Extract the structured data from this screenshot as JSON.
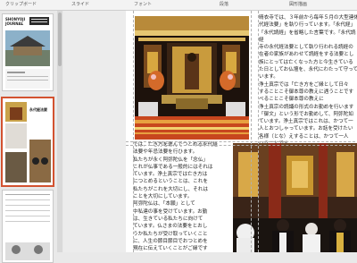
{
  "ribbon": {
    "groups": [
      "クリップボード",
      "スライド",
      "フォント",
      "段落",
      "図形描画"
    ]
  },
  "thumbnails": [
    {
      "masthead": "SHONYOJI\nJOURNAL"
    },
    {
      "masthead": "永代経法要"
    },
    {
      "masthead": ""
    }
  ],
  "document": {
    "right_column": "晴衣寺では、３年前から毎年５月の大型連休\n代経法要」を執り行っています。「永代経」\n「永代読経」を省略した言葉です。「永代読経\n寺の永代経法要として執り行われる読経の\n在者の家族があわせて読経をする法要とし\n族にとっては亡くなった方と今生きている\nた日としてお仏壇を、永代にわたって守って\nいます。\n浄土真宗では「亡き方をご縁として日々\nすることこそ御本尊の教えに遇うことです\nべることこそ御本尊の教えに\n浄土真宗の読誦の形式のお勤めを行います\n「御文」という形でお勤めして、阿弥陀如\nています。浄土真宗ではこれは、かつて一\n人とおつしゃっています。お話を受けたい\n各様（とな）えすることは、かつて一人\nいうことです。",
    "left_column": "では、亡き方を偲んでつとめる永代経\n法要や年忌法要を行ひます。\n私たちが永く阿弥陀仏を「念仏」\nこれが仏事である一般的にはそれは\nています。浄土真宗では亡き方は\nにつとめるということは、これを\n私たちがこれを大切にし、それは\nことを大切にしています。\n阿弥陀仏は、「本願」として\n中私達の事を受けています。お勤\nは、生きている私たちに向けて\nています。仏さまの法要をとおし\nうか私たちが受け取っていくこと\nに、人生の節目節目でおつとめを\n現在に伝えていくことがご縁です\nいただき、ご先祖を偲ぶことで\nていただいています。このご縁を"
  }
}
